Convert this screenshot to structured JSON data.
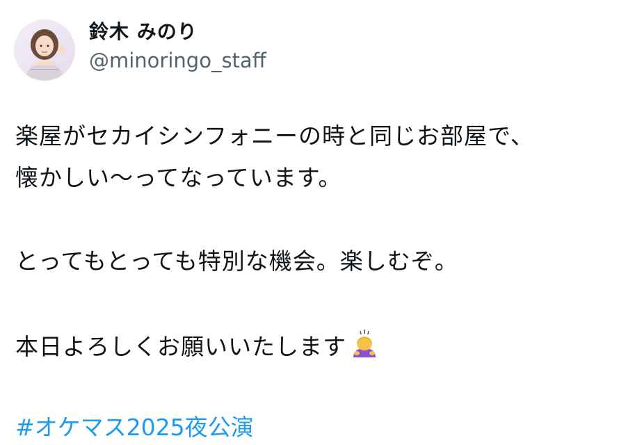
{
  "author": {
    "display_name": "鈴木 みのり",
    "handle": "@minoringo_staff"
  },
  "post": {
    "lines": [
      "楽屋がセカイシンフォニーの時と同じお部屋で、",
      "懐かしい〜ってなっています。",
      "とってもとっても特別な機会。楽しむぞ。",
      "本日よろしくお願いいたします"
    ],
    "emoji": "person-bowing-emoji",
    "hashtag": "#オケマス2025夜公演"
  },
  "colors": {
    "text": "#0f1419",
    "handle": "#536471",
    "hashtag": "#1d9bf0"
  }
}
